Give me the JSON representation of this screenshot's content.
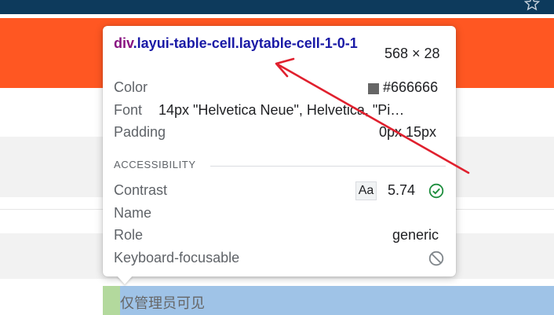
{
  "page": {
    "cell_text": "仅管理员可见"
  },
  "tooltip": {
    "selector_tag": "div",
    "selector_classes": ".layui-table-cell.laytable-cell-1-0-1",
    "size": "568 × 28",
    "rows": {
      "color_label": "Color",
      "color_value": "#666666",
      "font_label": "Font",
      "font_value": "14px \"Helvetica Neue\", Helvetica, \"Pi…",
      "padding_label": "Padding",
      "padding_value": "0px 15px"
    },
    "accessibility": {
      "heading": "ACCESSIBILITY",
      "contrast_label": "Contrast",
      "contrast_aa": "Aa",
      "contrast_value": "5.74",
      "name_label": "Name",
      "role_label": "Role",
      "role_value": "generic",
      "focusable_label": "Keyboard-focusable"
    }
  },
  "colors": {
    "orange_bar": "#ff5722",
    "top_bar": "#0d3a5c",
    "highlight": "#9fc3e7",
    "padding_highlight": "#b3d99d",
    "annotation_arrow": "#e0202e",
    "contrast_ok": "#1e8e3e"
  },
  "icons": {
    "topbar": "star-icon",
    "contrast_status": "check-circle-icon",
    "focusable_status": "blocked-circle-icon",
    "annotation": "red-arrow-annotation"
  }
}
